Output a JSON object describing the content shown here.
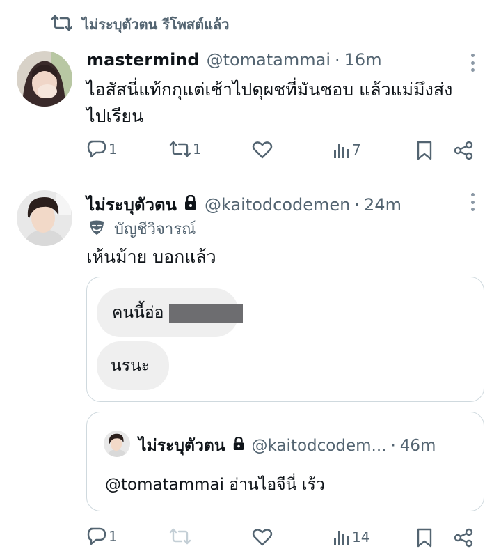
{
  "repost_banner": {
    "icon": "repost-icon",
    "text": "ไม่ระบุตัวตน รีโพสต์แล้ว"
  },
  "tweet1": {
    "name": "mastermind",
    "handle": "@tomatammai",
    "separator": "·",
    "time": "16m",
    "text_line1": "ไอสัสนี่แท้กกุแต่เช้าไปดุผชที่มันชอบ แล้วแม่มึงส่ง",
    "text_line2": "ไปเรียน",
    "actions": {
      "replies": "1",
      "reposts": "1",
      "views": "7"
    }
  },
  "tweet2": {
    "name": "ไม่ระบุตัวตน",
    "handle": "@kaitodcodemen",
    "separator": "·",
    "time": "24m",
    "badge_label": "บัญชีวิจารณ์",
    "text": "เห้นม้าย บอกแล้ว",
    "chat_bubbles": [
      "คนนี้อ่อ",
      "นรนะ"
    ],
    "quoted": {
      "name": "ไม่ระบุตัวตน",
      "handle": "@kaitodcodem...",
      "separator": "·",
      "time": "46m",
      "text": "@tomatammai อ่านไอจีนี่ เร้ว"
    },
    "actions": {
      "replies": "1",
      "reposts": "",
      "views": "14"
    }
  },
  "colors": {
    "text": "#0f1419",
    "muted": "#536471",
    "divider": "#e1e8ed",
    "border": "#cfd9de",
    "bubble": "#efefef"
  }
}
